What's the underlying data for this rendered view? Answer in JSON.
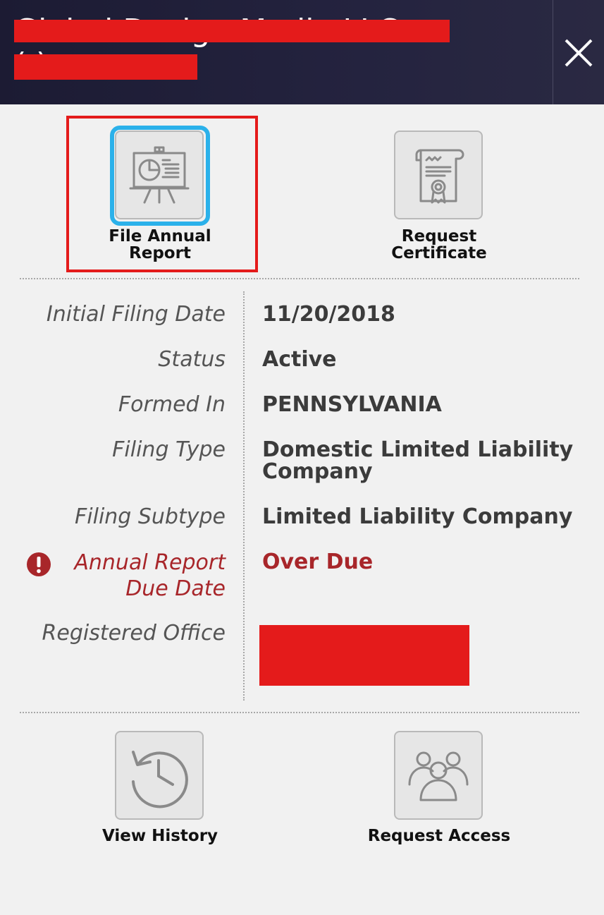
{
  "header": {
    "title_line1": "Global Design Media LLC",
    "title_line2": "(            )"
  },
  "actions": {
    "file_annual_report": "File Annual Report",
    "request_certificate": "Request Certificate",
    "view_history": "View History",
    "request_access": "Request Access"
  },
  "details": [
    {
      "label": "Initial Filing Date",
      "value": "11/20/2018"
    },
    {
      "label": "Status",
      "value": "Active"
    },
    {
      "label": "Formed In",
      "value": "PENNSYLVANIA"
    },
    {
      "label": "Filing Type",
      "value": "Domestic Limited Liability Company"
    },
    {
      "label": "Filing Subtype",
      "value": "Limited Liability Company"
    },
    {
      "label": "Annual Report Due Date",
      "value": "Over Due"
    },
    {
      "label": "Registered Office",
      "value": ""
    }
  ],
  "colors": {
    "accent_red": "#a8262a",
    "redaction": "#e41b1b",
    "focus_blue": "#2bb1ea",
    "header_bg": "#1c1b33"
  },
  "icons": {
    "file_annual_report": "presentation-board-icon",
    "request_certificate": "certificate-scroll-icon",
    "view_history": "history-clock-icon",
    "request_access": "user-group-icon",
    "close": "close-icon",
    "warning": "exclamation-icon"
  }
}
